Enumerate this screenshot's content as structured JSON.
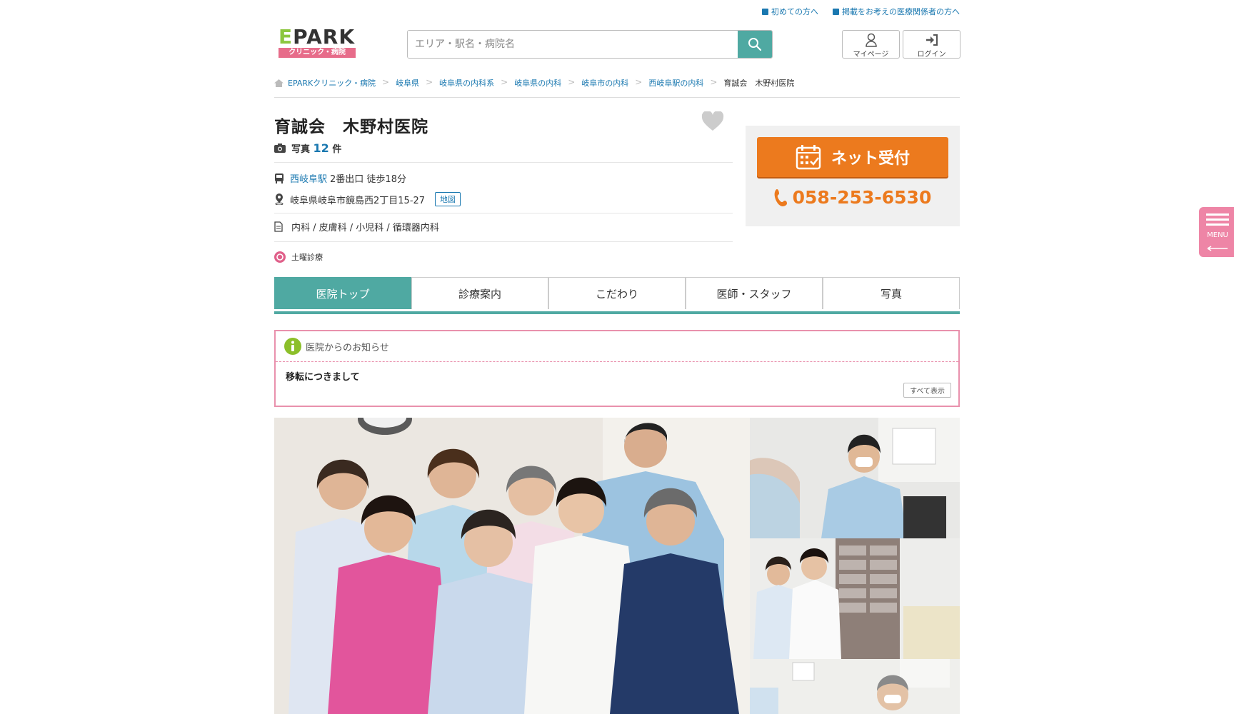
{
  "top_links": [
    "初めての方へ",
    "掲載をお考えの医療関係者の方へ"
  ],
  "logo": {
    "word_e": "E",
    "word_rest": "PARK",
    "sub": "クリニック・病院"
  },
  "search": {
    "placeholder": "エリア・駅名・病院名"
  },
  "user_buttons": {
    "mypage": "マイページ",
    "login": "ログイン"
  },
  "breadcrumb": [
    "EPARKクリニック・病院",
    "岐阜県",
    "岐阜県の内科系",
    "岐阜県の内科",
    "岐阜市の内科",
    "西岐阜駅の内科",
    "育誠会　木野村医院"
  ],
  "clinic": {
    "name": "育誠会　木野村医院",
    "photo_label": "写真",
    "photo_count": "12",
    "photo_unit": "件",
    "station": "西岐阜駅",
    "access": "2番出口 徒歩18分",
    "address": "岐阜県岐阜市鏡島西2丁目15-27",
    "map_label": "地図",
    "departments": "内科 / 皮膚科 / 小児科 / 循環器内科",
    "feature": "土曜診療"
  },
  "side": {
    "net_reserve": "ネット受付",
    "tel": "058-253-6530"
  },
  "tabs": [
    "医院トップ",
    "診療案内",
    "こだわり",
    "医師・スタッフ",
    "写真"
  ],
  "notice": {
    "header": "医院からのお知らせ",
    "title": "移転につきまして",
    "all_label": "すべて表示"
  },
  "side_menu": {
    "label": "MENU"
  },
  "colors": {
    "teal": "#4fa9a2",
    "orange": "#ec7a1e",
    "pink": "#e991ad",
    "link": "#1a78b0"
  }
}
